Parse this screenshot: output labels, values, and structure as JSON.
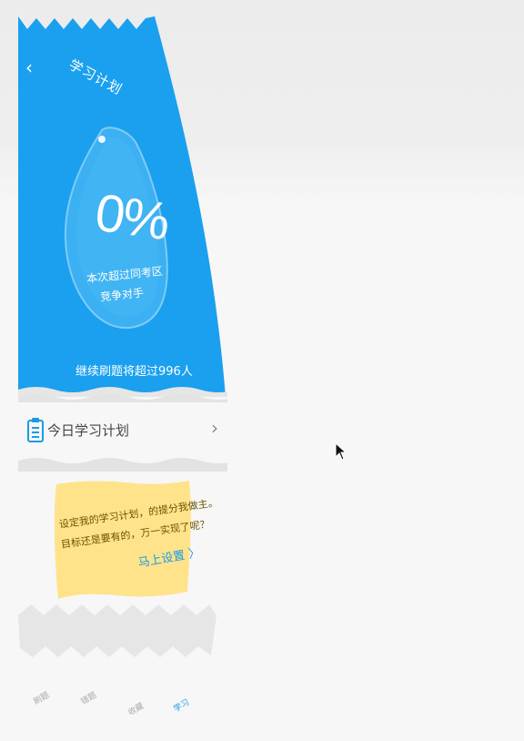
{
  "header": {
    "back_label": "‹",
    "title": "学习计划"
  },
  "stats": {
    "percent": "0%",
    "beat_line1": "本次超过同考区",
    "beat_line2": "竞争对手",
    "continue_text": "继续刷题将超过996人"
  },
  "plan": {
    "label": "今日学习计划",
    "arrow": "›"
  },
  "note": {
    "line1": "设定我的学习计划，的提分我做主。",
    "line2": "目标还是要有的，万一实现了呢？",
    "link": "马上设置 〉"
  },
  "tabs": [
    {
      "label": "刷题"
    },
    {
      "label": "错题"
    },
    {
      "label": "收藏"
    },
    {
      "label": "学习"
    }
  ],
  "colors": {
    "blue": "#1aa0ef",
    "note_yellow": "#ffe38a",
    "accent": "#1a9be6"
  },
  "icons": [
    "clipboard-icon",
    "chevron-right-icon",
    "back-icon",
    "cursor-icon"
  ]
}
